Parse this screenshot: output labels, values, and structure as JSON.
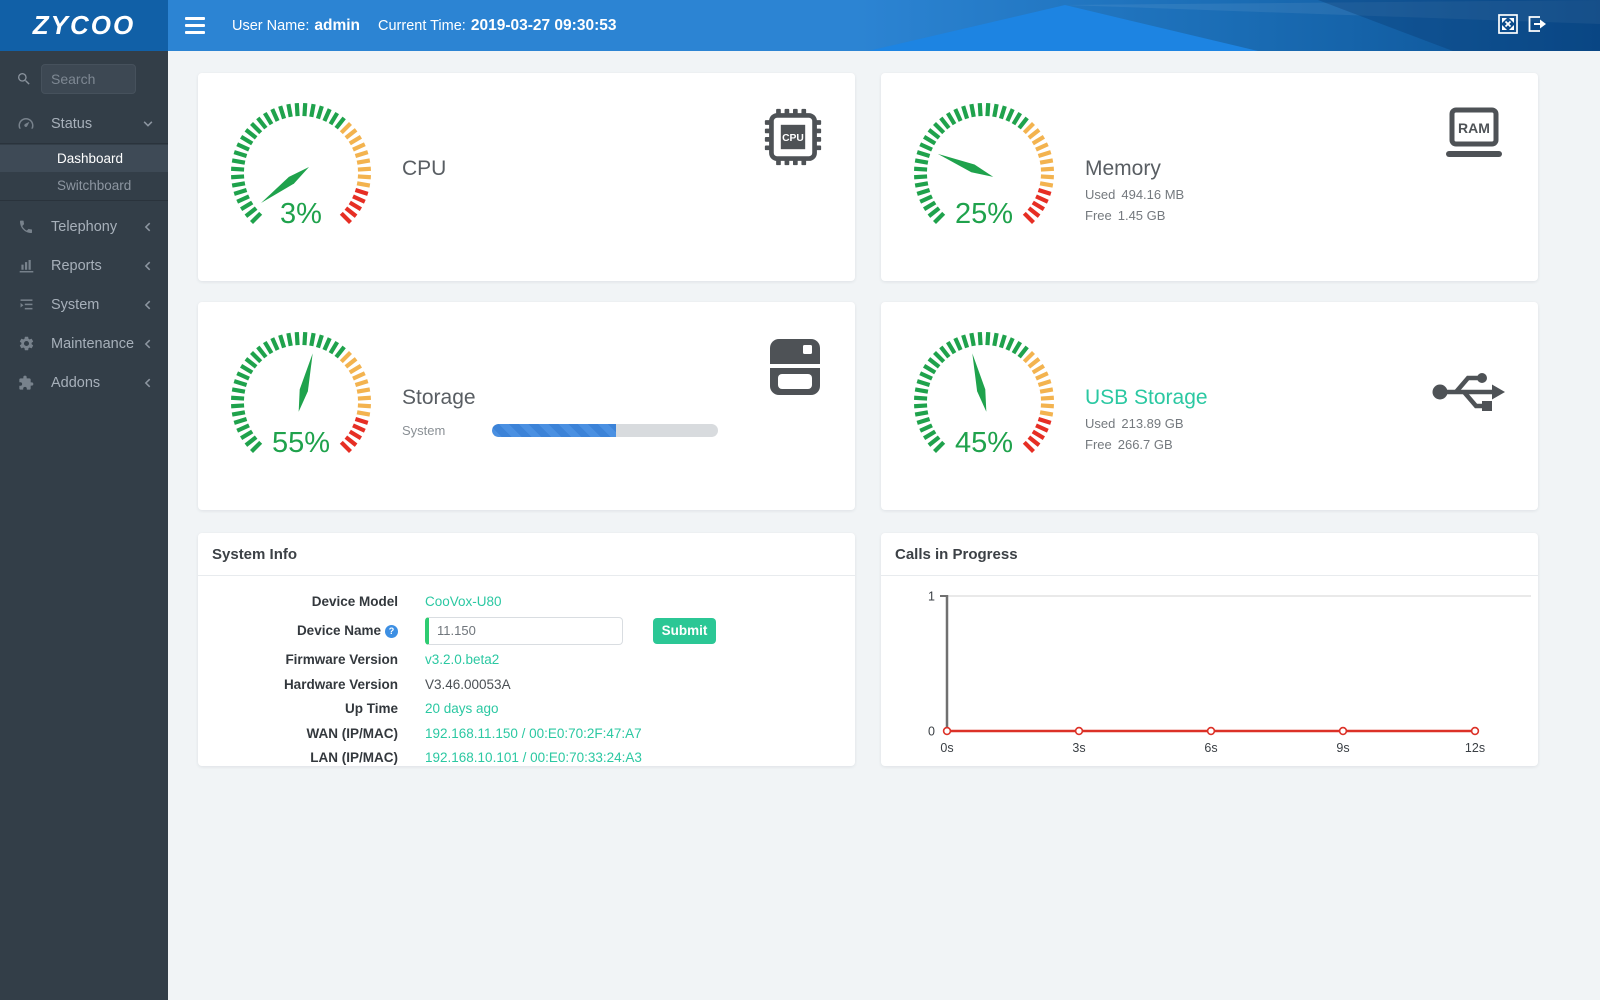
{
  "header": {
    "logo": "ZYCOO",
    "user_label": "User Name:",
    "user_value": "admin",
    "time_label": "Current Time:",
    "time_value": "2019-03-27 09:30:53"
  },
  "sidebar": {
    "search_placeholder": "Search",
    "items": [
      {
        "label": "Status",
        "icon": "speedometer-icon",
        "state": "expanded"
      },
      {
        "label": "Telephony",
        "icon": "phone-icon",
        "state": "collapsed"
      },
      {
        "label": "Reports",
        "icon": "bar-chart-icon",
        "state": "collapsed"
      },
      {
        "label": "System",
        "icon": "list-icon",
        "state": "collapsed"
      },
      {
        "label": "Maintenance",
        "icon": "gear-icon",
        "state": "collapsed"
      },
      {
        "label": "Addons",
        "icon": "puzzle-icon",
        "state": "collapsed"
      }
    ],
    "submenu": {
      "parent": "Status",
      "items": [
        {
          "label": "Dashboard",
          "active": true
        },
        {
          "label": "Switchboard",
          "active": false
        }
      ]
    }
  },
  "gauges": [
    {
      "title": "CPU",
      "percent": 3,
      "percent_label": "3%",
      "icon": "cpu-chip-icon",
      "details": []
    },
    {
      "title": "Memory",
      "percent": 25,
      "percent_label": "25%",
      "icon": "ram-icon",
      "details": [
        {
          "k": "Used",
          "v": "494.16 MB"
        },
        {
          "k": "Free",
          "v": "1.45 GB"
        }
      ]
    },
    {
      "title": "Storage",
      "percent": 55,
      "percent_label": "55%",
      "icon": "floppy-disk-icon",
      "partition": {
        "label": "System",
        "fill_percent": 55
      }
    },
    {
      "title": "USB Storage",
      "percent": 45,
      "percent_label": "45%",
      "icon": "usb-icon",
      "title_accent": true,
      "details": [
        {
          "k": "Used",
          "v": "213.89 GB"
        },
        {
          "k": "Free",
          "v": "266.7 GB"
        }
      ]
    }
  ],
  "system_info": {
    "title": "System Info",
    "rows": [
      {
        "label": "Device Model",
        "value": "CooVox-U80",
        "style": "link"
      },
      {
        "label": "Device Name",
        "value": "11.150",
        "type": "input",
        "button_label": "Submit",
        "help": true
      },
      {
        "label": "Firmware Version",
        "value": "v3.2.0.beta2",
        "style": "link"
      },
      {
        "label": "Hardware Version",
        "value": "V3.46.00053A",
        "style": "plain"
      },
      {
        "label": "Up Time",
        "value": "20 days ago",
        "style": "link"
      },
      {
        "label": "WAN (IP/MAC)",
        "value": "192.168.11.150 / 00:E0:70:2F:47:A7",
        "style": "link"
      },
      {
        "label": "LAN (IP/MAC)",
        "value": "192.168.10.101 / 00:E0:70:33:24:A3",
        "style": "link"
      }
    ]
  },
  "chart_data": {
    "type": "line",
    "title": "Calls in Progress",
    "x_ticks": [
      0,
      3,
      6,
      9,
      12
    ],
    "x_tick_labels": [
      "0s",
      "3s",
      "6s",
      "9s",
      "12s"
    ],
    "xlabel": "",
    "ylabel": "",
    "ylim": [
      0,
      1
    ],
    "y_ticks": [
      0,
      1
    ],
    "series": [
      {
        "name": "Calls in Progress",
        "x": [
          0,
          3,
          6,
          9,
          12
        ],
        "values": [
          0,
          0,
          0,
          0,
          0
        ]
      }
    ],
    "line_color": "#dc3127",
    "marker": "open-circle",
    "grid": "top-gridline-only",
    "legend": "none"
  },
  "colors": {
    "header_blue": "#2c84d3",
    "header_dark_blue": "#0b5092",
    "logo_block_blue": "#1160a7",
    "sidebar_bg": "#333e48",
    "sidebar_active_bg": "#3e4a56",
    "accent_teal": "#2bc8a2",
    "submit_green": "#2bc795",
    "input_stripe_green": "#2ecc71",
    "gauge_green": "#1fa24c",
    "gauge_orange": "#f3b34f",
    "gauge_red": "#e62e24",
    "chart_line_red": "#dc3127",
    "storage_bar_blue": "#4a90e2"
  }
}
